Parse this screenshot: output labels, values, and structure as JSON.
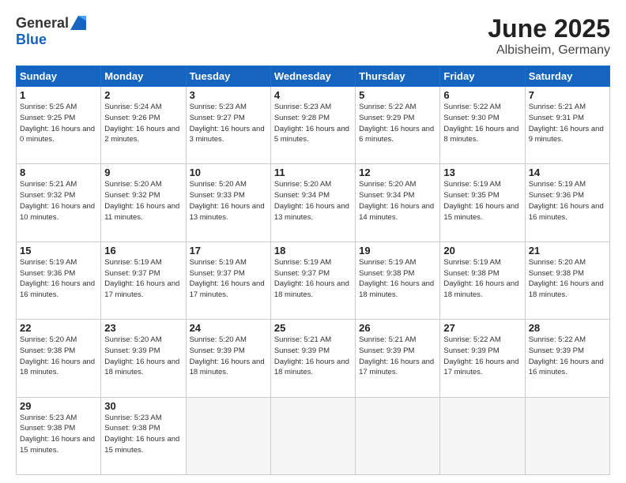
{
  "header": {
    "logo_general": "General",
    "logo_blue": "Blue",
    "title": "June 2025",
    "subtitle": "Albisheim, Germany"
  },
  "days_of_week": [
    "Sunday",
    "Monday",
    "Tuesday",
    "Wednesday",
    "Thursday",
    "Friday",
    "Saturday"
  ],
  "weeks": [
    [
      {
        "day": 1,
        "sunrise": "5:25 AM",
        "sunset": "9:25 PM",
        "daylight": "16 hours and 0 minutes."
      },
      {
        "day": 2,
        "sunrise": "5:24 AM",
        "sunset": "9:26 PM",
        "daylight": "16 hours and 2 minutes."
      },
      {
        "day": 3,
        "sunrise": "5:23 AM",
        "sunset": "9:27 PM",
        "daylight": "16 hours and 3 minutes."
      },
      {
        "day": 4,
        "sunrise": "5:23 AM",
        "sunset": "9:28 PM",
        "daylight": "16 hours and 5 minutes."
      },
      {
        "day": 5,
        "sunrise": "5:22 AM",
        "sunset": "9:29 PM",
        "daylight": "16 hours and 6 minutes."
      },
      {
        "day": 6,
        "sunrise": "5:22 AM",
        "sunset": "9:30 PM",
        "daylight": "16 hours and 8 minutes."
      },
      {
        "day": 7,
        "sunrise": "5:21 AM",
        "sunset": "9:31 PM",
        "daylight": "16 hours and 9 minutes."
      }
    ],
    [
      {
        "day": 8,
        "sunrise": "5:21 AM",
        "sunset": "9:32 PM",
        "daylight": "16 hours and 10 minutes."
      },
      {
        "day": 9,
        "sunrise": "5:20 AM",
        "sunset": "9:32 PM",
        "daylight": "16 hours and 11 minutes."
      },
      {
        "day": 10,
        "sunrise": "5:20 AM",
        "sunset": "9:33 PM",
        "daylight": "16 hours and 13 minutes."
      },
      {
        "day": 11,
        "sunrise": "5:20 AM",
        "sunset": "9:34 PM",
        "daylight": "16 hours and 13 minutes."
      },
      {
        "day": 12,
        "sunrise": "5:20 AM",
        "sunset": "9:34 PM",
        "daylight": "16 hours and 14 minutes."
      },
      {
        "day": 13,
        "sunrise": "5:19 AM",
        "sunset": "9:35 PM",
        "daylight": "16 hours and 15 minutes."
      },
      {
        "day": 14,
        "sunrise": "5:19 AM",
        "sunset": "9:36 PM",
        "daylight": "16 hours and 16 minutes."
      }
    ],
    [
      {
        "day": 15,
        "sunrise": "5:19 AM",
        "sunset": "9:36 PM",
        "daylight": "16 hours and 16 minutes."
      },
      {
        "day": 16,
        "sunrise": "5:19 AM",
        "sunset": "9:37 PM",
        "daylight": "16 hours and 17 minutes."
      },
      {
        "day": 17,
        "sunrise": "5:19 AM",
        "sunset": "9:37 PM",
        "daylight": "16 hours and 17 minutes."
      },
      {
        "day": 18,
        "sunrise": "5:19 AM",
        "sunset": "9:37 PM",
        "daylight": "16 hours and 18 minutes."
      },
      {
        "day": 19,
        "sunrise": "5:19 AM",
        "sunset": "9:38 PM",
        "daylight": "16 hours and 18 minutes."
      },
      {
        "day": 20,
        "sunrise": "5:19 AM",
        "sunset": "9:38 PM",
        "daylight": "16 hours and 18 minutes."
      },
      {
        "day": 21,
        "sunrise": "5:20 AM",
        "sunset": "9:38 PM",
        "daylight": "16 hours and 18 minutes."
      }
    ],
    [
      {
        "day": 22,
        "sunrise": "5:20 AM",
        "sunset": "9:38 PM",
        "daylight": "16 hours and 18 minutes."
      },
      {
        "day": 23,
        "sunrise": "5:20 AM",
        "sunset": "9:39 PM",
        "daylight": "16 hours and 18 minutes."
      },
      {
        "day": 24,
        "sunrise": "5:20 AM",
        "sunset": "9:39 PM",
        "daylight": "16 hours and 18 minutes."
      },
      {
        "day": 25,
        "sunrise": "5:21 AM",
        "sunset": "9:39 PM",
        "daylight": "16 hours and 18 minutes."
      },
      {
        "day": 26,
        "sunrise": "5:21 AM",
        "sunset": "9:39 PM",
        "daylight": "16 hours and 17 minutes."
      },
      {
        "day": 27,
        "sunrise": "5:22 AM",
        "sunset": "9:39 PM",
        "daylight": "16 hours and 17 minutes."
      },
      {
        "day": 28,
        "sunrise": "5:22 AM",
        "sunset": "9:39 PM",
        "daylight": "16 hours and 16 minutes."
      }
    ],
    [
      {
        "day": 29,
        "sunrise": "5:23 AM",
        "sunset": "9:38 PM",
        "daylight": "16 hours and 15 minutes."
      },
      {
        "day": 30,
        "sunrise": "5:23 AM",
        "sunset": "9:38 PM",
        "daylight": "16 hours and 15 minutes."
      },
      null,
      null,
      null,
      null,
      null
    ]
  ]
}
